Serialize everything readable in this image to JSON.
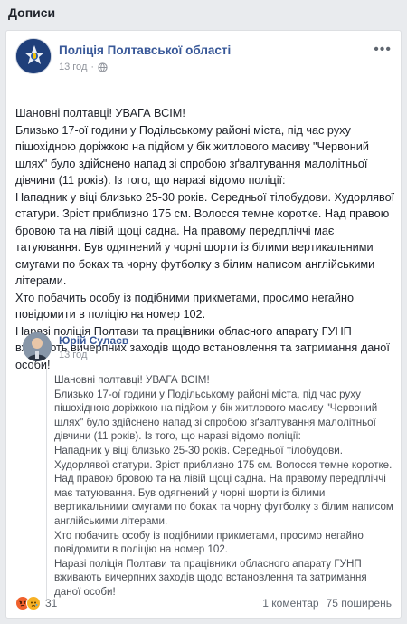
{
  "section": {
    "title": "Дописи"
  },
  "post": {
    "page_name": "Поліція Полтавської області",
    "time": "13 год",
    "text": [
      "Шановні полтавці! УВАГА ВСІМ!",
      "Близько 17-ої години у Подільському районі міста, під час руху пішохідною доріжкою на підйом у бік житлового масиву \"Червоний шлях\" було здійснено напад зі спробою зґвалтування малолітньої дівчини (11 років). Із того, що наразі відомо поліції:",
      "Нападник у віці близько 25-30 років. Середньої тілобудови. Худорлявої статури. Зріст приблизно 175 см. Волосся темне коротке. Над правою бровою та на лівій щоці садна. На правому передпліччі має татуювання. Був одягнений у чорні шорти із білими вертикальними смугами по боках та чорну футболку з білим написом англійськими літерами.",
      "Хто побачить особу із подібними прикметами, просимо негайно повідомити в поліцію на номер 102.",
      "Наразі поліція Полтави та працівники обласного апарату ГУНП вживають вичерпних заходів щодо встановлення та затримання даної особи!"
    ]
  },
  "shared": {
    "name": "Юрій Сулаєв",
    "time": "13 год",
    "text": [
      "Шановні полтавці! УВАГА ВСІМ!",
      "Близько 17-ої години у Подільському районі міста, під час руху пішохідною доріжкою на підйом у бік житлового масиву \"Червоний шлях\" було здійснено напад зі спробою зґвалтування малолітньої дівчини (11 років). Із того, що наразі відомо поліції:",
      "Нападник у віці близько 25-30 років. Середньої тілобудови. Худорлявої статури. Зріст приблизно 175 см. Волосся темне коротке. Над правою бровою та на лівій щоці садна. На правому передпліччі має татуювання. Був одягнений у чорні шорти із білими вертикальними смугами по боках та чорну футболку з білим написом англійськими літерами.",
      "Хто побачить особу із подібними прикметами, просимо негайно повідомити в поліцію на номер 102.",
      "Наразі поліція Полтави та працівники обласного апарату ГУНП вживають вичерпних заходів щодо встановлення та затримання даної особи!"
    ]
  },
  "footer": {
    "reactions_count": "31",
    "comments": "1 коментар",
    "shares": "75 поширень"
  },
  "icons": {
    "more": "more-options-icon",
    "globe": "globe-icon",
    "reaction1": "angry-reaction-icon",
    "reaction2": "sad-reaction-icon"
  }
}
